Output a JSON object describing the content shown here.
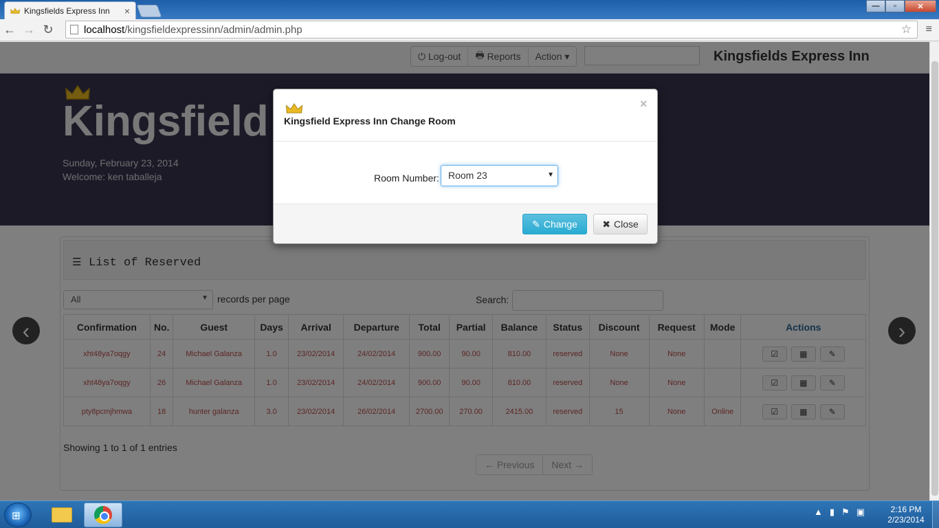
{
  "browser": {
    "tab_title": "Kingsfields Express Inn",
    "tab_close": "×",
    "url_host": "localhost",
    "url_path": "/kingsfieldexpressinn/admin/admin.php",
    "window_buttons": {
      "minimize": "—",
      "maximize": "▫",
      "close": "✕"
    }
  },
  "nav": {
    "logout": "Log-out",
    "reports": "Reports",
    "action": "Action",
    "brand": "Kingsfields Express Inn"
  },
  "hero": {
    "title": "Kingsfield I",
    "date": "Sunday, February 23, 2014",
    "welcome": "Welcome:  ken taballeja"
  },
  "panel": {
    "title": "List of Reserved",
    "length_value": "All",
    "length_label": "records per page",
    "search_label": "Search:",
    "columns": [
      "Confirmation",
      "No.",
      "Guest",
      "Days",
      "Arrival",
      "Departure",
      "Total",
      "Partial",
      "Balance",
      "Status",
      "Discount",
      "Request",
      "Mode",
      "Actions"
    ],
    "rows": [
      [
        "xht48ya7oqgy",
        "24",
        "Michael Galanza",
        "1.0",
        "23/02/2014",
        "24/02/2014",
        "900.00",
        "90.00",
        "810.00",
        "reserved",
        "None",
        "None",
        ""
      ],
      [
        "xht48ya7oqgy",
        "26",
        "Michael Galanza",
        "1.0",
        "23/02/2014",
        "24/02/2014",
        "900.00",
        "90.00",
        "810.00",
        "reserved",
        "None",
        "None",
        ""
      ],
      [
        "pty8pcmjhmwa",
        "18",
        "hunter galanza",
        "3.0",
        "23/02/2014",
        "26/02/2014",
        "2700.00",
        "270.00",
        "2415.00",
        "reserved",
        "15",
        "None",
        "Online"
      ]
    ],
    "info": "Showing 1 to 1 of 1 entries",
    "prev": "← Previous",
    "next": "Next →"
  },
  "modal": {
    "title": "Kingsfield Express Inn Change Room",
    "close_x": "×",
    "room_label": "Room Number:",
    "room_value": "Room 23",
    "change_label": "Change",
    "close_label": "Close"
  },
  "taskbar": {
    "time": "2:16 PM",
    "date": "2/23/2014"
  },
  "colors": {
    "accent": "#5bc0de",
    "hero_bg": "#3a3451",
    "cell_text": "#b94a48",
    "link": "#2a6496"
  }
}
